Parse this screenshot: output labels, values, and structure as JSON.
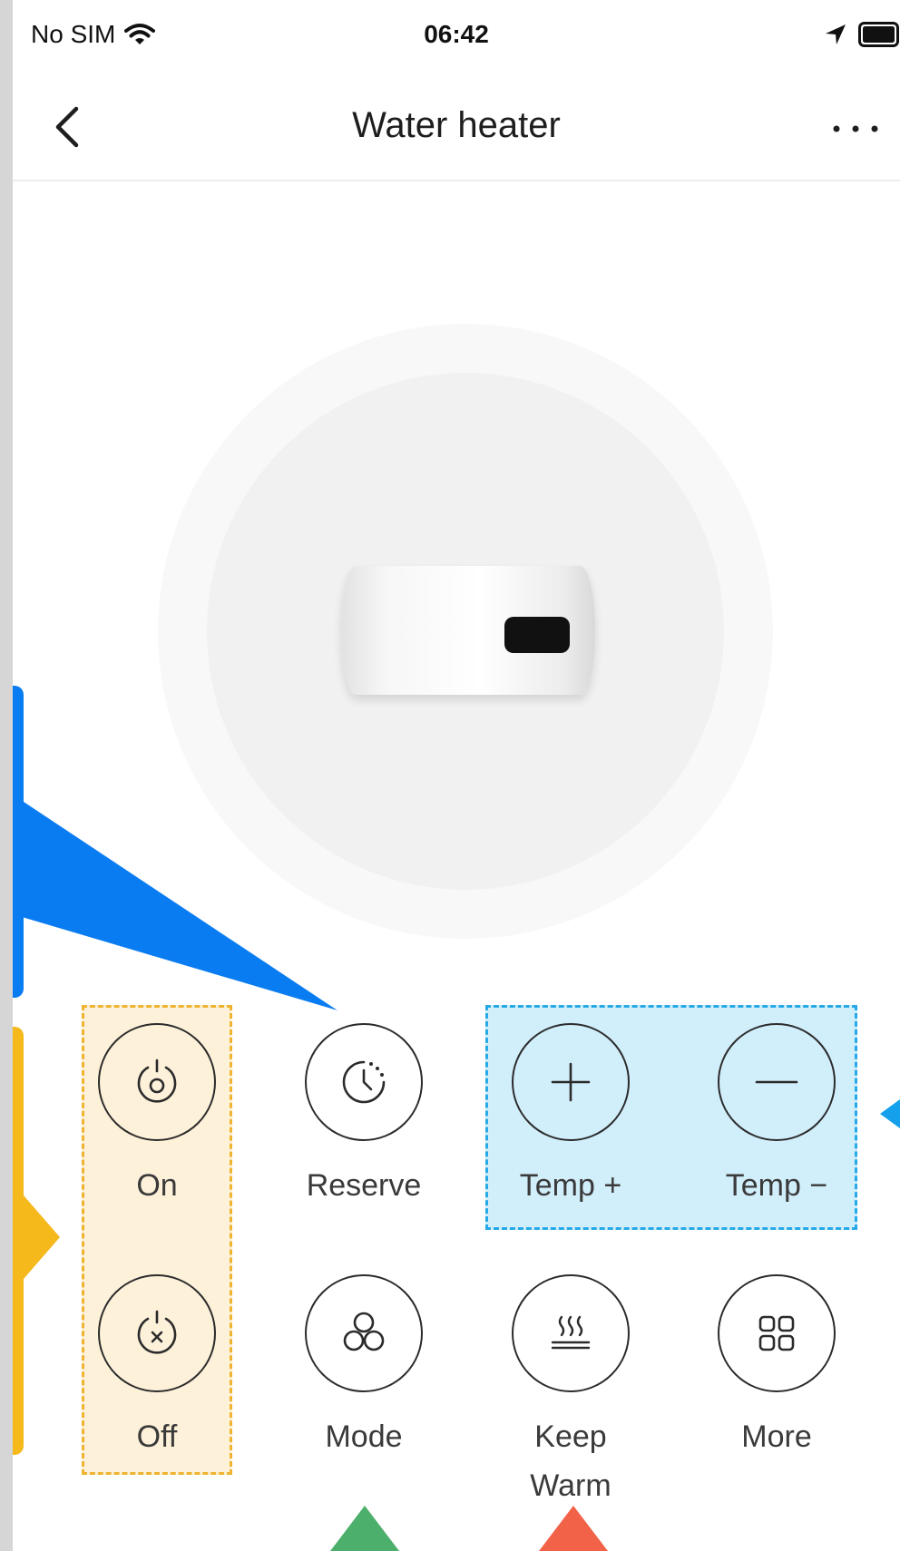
{
  "status_bar": {
    "carrier": "No SIM",
    "time": "06:42"
  },
  "navbar": {
    "title": "Water heater"
  },
  "device": {
    "name": "water-heater-image"
  },
  "controls": {
    "on": "On",
    "reserve": "Reserve",
    "temp_plus": "Temp +",
    "temp_minus": "Temp −",
    "off": "Off",
    "mode": "Mode",
    "keep_warm": "Keep\nWarm",
    "more": "More"
  },
  "colors": {
    "callout_blue": "#0a7cf2",
    "callout_yellow": "#f5b91c",
    "highlight_power": "#fdf1da",
    "highlight_temp": "#d1eefb",
    "pointer_green": "#4caf6b",
    "pointer_red": "#f26249"
  },
  "icons": [
    "wifi-icon",
    "location-arrow-icon",
    "battery-icon",
    "back-chevron-icon",
    "more-dots-icon",
    "power-on-icon",
    "clock-icon",
    "plus-icon",
    "minus-icon",
    "power-off-icon",
    "mode-icon",
    "keep-warm-icon",
    "grid-icon"
  ]
}
